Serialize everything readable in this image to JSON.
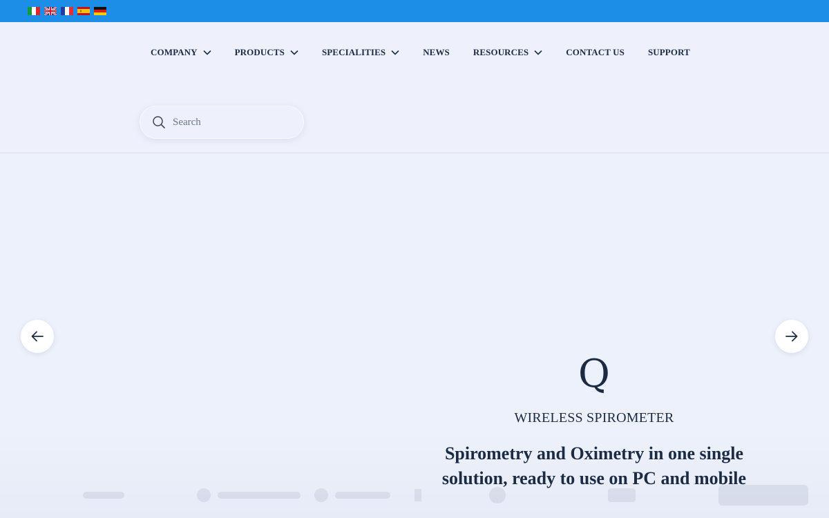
{
  "colors": {
    "topbar": "#1c8ee8",
    "text": "#1c2b44",
    "background": "#eef1fb"
  },
  "languages": [
    {
      "name": "Italian",
      "icon": "italy-flag-icon"
    },
    {
      "name": "English",
      "icon": "uk-flag-icon"
    },
    {
      "name": "French",
      "icon": "france-flag-icon"
    },
    {
      "name": "Spanish",
      "icon": "spain-flag-icon"
    },
    {
      "name": "German",
      "icon": "germany-flag-icon"
    }
  ],
  "nav": {
    "company": "COMPANY",
    "products": "PRODUCTS",
    "specialities": "SPECIALITIES",
    "news": "NEWS",
    "resources": "RESOURCES",
    "contact": "CONTACT US",
    "support": "SUPPORT"
  },
  "search": {
    "placeholder": "Search",
    "icon": "search-icon"
  },
  "slider": {
    "prev_icon": "arrow-left-icon",
    "next_icon": "arrow-right-icon",
    "brand_letter": "Q",
    "subtitle": "WIRELESS SPIROMETER",
    "headline_line1": "Spirometry and Oximetry in one single",
    "headline_line2": "solution, ready to use on PC and mobile"
  }
}
